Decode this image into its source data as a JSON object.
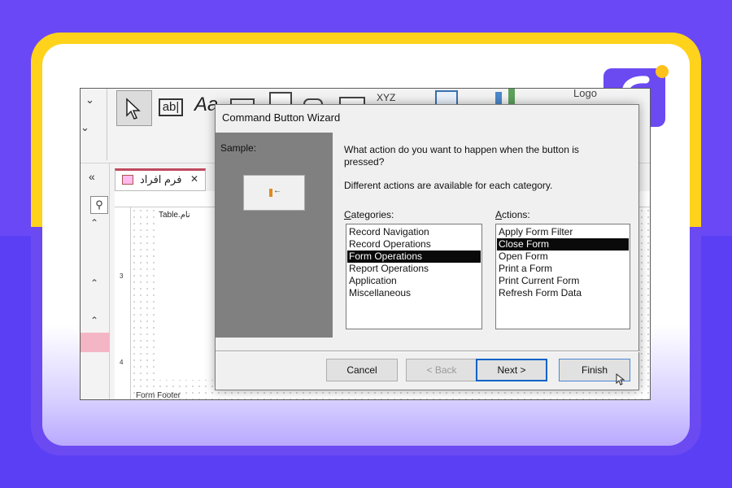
{
  "brand": {
    "tile_color": "#6b4af2",
    "dot_color": "#ffc21c",
    "frame_color": "#ffd21c"
  },
  "ribbon": {
    "textbox_label": "ab|",
    "label_tool": "Aa",
    "xyz": "XYZ",
    "logo_label": "Logo"
  },
  "nav": {
    "collapse": "«",
    "search_icon": "search-icon"
  },
  "document_tab": {
    "title": "فرم افراد",
    "close": "✕"
  },
  "design": {
    "field_text": "Table.نام",
    "ruler_marks": [
      "3",
      "4"
    ],
    "form_footer": "Form Footer"
  },
  "dialog": {
    "title": "Command Button Wizard",
    "sample_label": "Sample:",
    "question": "What action do you want to happen when the button is pressed?",
    "hint": "Different actions are available for each category.",
    "categories_label": "Categories:",
    "actions_label": "Actions:",
    "categories": [
      {
        "label": "Record Navigation",
        "selected": false
      },
      {
        "label": "Record Operations",
        "selected": false
      },
      {
        "label": "Form Operations",
        "selected": true
      },
      {
        "label": "Report Operations",
        "selected": false
      },
      {
        "label": "Application",
        "selected": false
      },
      {
        "label": "Miscellaneous",
        "selected": false
      }
    ],
    "actions": [
      {
        "label": "Apply Form Filter",
        "selected": false
      },
      {
        "label": "Close Form",
        "selected": true
      },
      {
        "label": "Open Form",
        "selected": false
      },
      {
        "label": "Print a Form",
        "selected": false
      },
      {
        "label": "Print Current Form",
        "selected": false
      },
      {
        "label": "Refresh Form Data",
        "selected": false
      }
    ],
    "buttons": {
      "cancel": "Cancel",
      "back": "< Back",
      "next": "Next >",
      "finish": "Finish"
    }
  }
}
